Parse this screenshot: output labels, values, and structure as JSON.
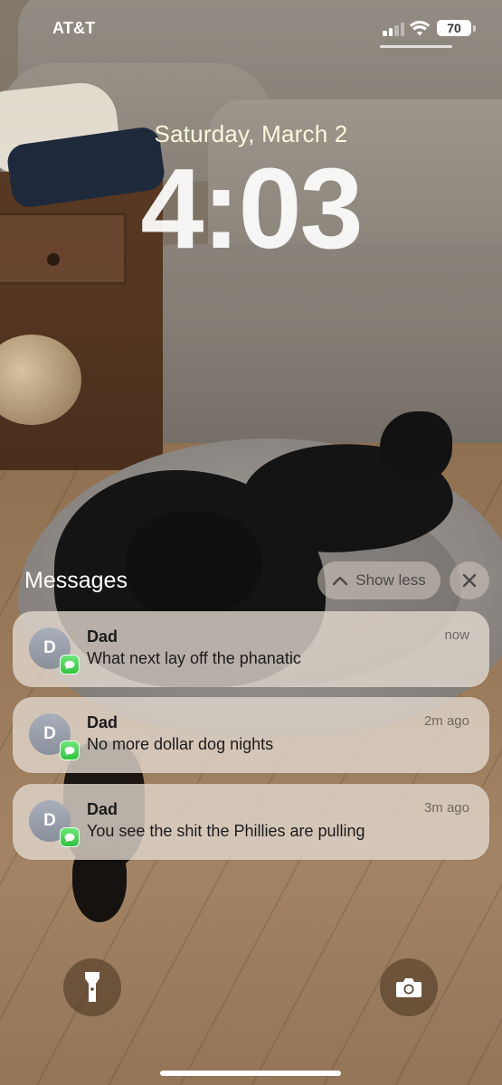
{
  "status_bar": {
    "carrier": "AT&T",
    "battery_level": "70",
    "signal_bars_active": 2,
    "signal_bars_total": 4
  },
  "lock_screen": {
    "date": "Saturday, March 2",
    "time": "4:03"
  },
  "notification_group": {
    "title": "Messages",
    "show_less_label": "Show less",
    "notifications": [
      {
        "avatar_initial": "D",
        "sender": "Dad",
        "message": "What next lay off the phanatic",
        "timestamp": "now",
        "app_icon": "messages-icon"
      },
      {
        "avatar_initial": "D",
        "sender": "Dad",
        "message": "No more dollar dog nights",
        "timestamp": "2m ago",
        "app_icon": "messages-icon"
      },
      {
        "avatar_initial": "D",
        "sender": "Dad",
        "message": "You see the shit the Phillies are pulling",
        "timestamp": "3m ago",
        "app_icon": "messages-icon"
      }
    ]
  },
  "quick_actions": {
    "left_icon": "flashlight-icon",
    "right_icon": "camera-icon"
  },
  "colors": {
    "messages_green": "#34c759",
    "notification_bg": "#e1d7cd",
    "avatar_gray": "#9a9fab"
  }
}
